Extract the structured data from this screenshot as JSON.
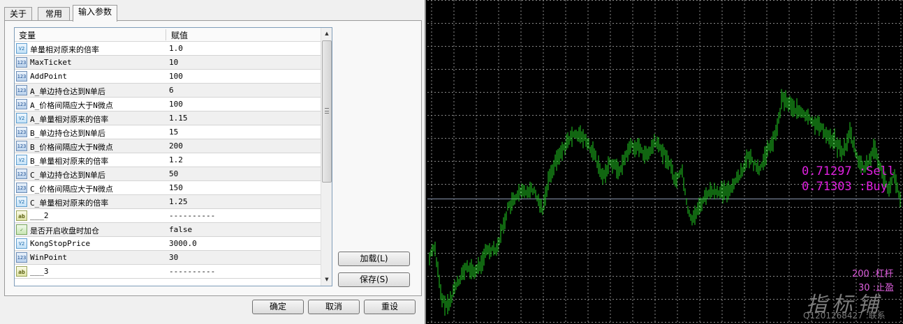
{
  "tabs": [
    "关于",
    "常用",
    "输入参数"
  ],
  "grid": {
    "header_name": "变量",
    "header_value": "赋值",
    "rows": [
      {
        "icon": "v",
        "name": "单量相对原来的倍率",
        "value": "1.0"
      },
      {
        "icon": "123",
        "name": "MaxTicket",
        "value": "10"
      },
      {
        "icon": "123",
        "name": "AddPoint",
        "value": "100"
      },
      {
        "icon": "123",
        "name": "A_单边持仓达到N单后",
        "value": "6"
      },
      {
        "icon": "123",
        "name": "A_价格间隔应大于N微点",
        "value": "100"
      },
      {
        "icon": "v",
        "name": "A_单量相对原来的倍率",
        "value": "1.15"
      },
      {
        "icon": "123",
        "name": "B_单边持仓达到N单后",
        "value": "15"
      },
      {
        "icon": "123",
        "name": "B_价格间隔应大于N微点",
        "value": "200"
      },
      {
        "icon": "v",
        "name": "B_单量相对原来的倍率",
        "value": "1.2"
      },
      {
        "icon": "123",
        "name": "C_单边持仓达到N单后",
        "value": "50"
      },
      {
        "icon": "123",
        "name": "C_价格间隔应大于N微点",
        "value": "150"
      },
      {
        "icon": "v",
        "name": "C_单量相对原来的倍率",
        "value": "1.25"
      },
      {
        "icon": "ab",
        "name": "___2",
        "value": "----------"
      },
      {
        "icon": "b",
        "name": "是否开启收盘时加仓",
        "value": "false"
      },
      {
        "icon": "v",
        "name": "KongStopPrice",
        "value": "3000.0"
      },
      {
        "icon": "123",
        "name": "WinPoint",
        "value": "30"
      },
      {
        "icon": "ab",
        "name": "___3",
        "value": "----------"
      }
    ]
  },
  "buttons": {
    "load": "加载(L)",
    "save": "保存(S)",
    "ok": "确定",
    "cancel": "取消",
    "reset": "重设"
  },
  "chart": {
    "sell_label": "0.71297 :Sell",
    "buy_label": "0.71303 :Buy",
    "leverage_label": "200 :杠杆",
    "takeprofit_label": "30 :止盈",
    "watermark": "指标铺",
    "footer_text": "Q1201268427 :联系",
    "colors": {
      "bars": "#22cc22",
      "grid": "#8a8a8a",
      "price_text": "#e020e0"
    }
  }
}
